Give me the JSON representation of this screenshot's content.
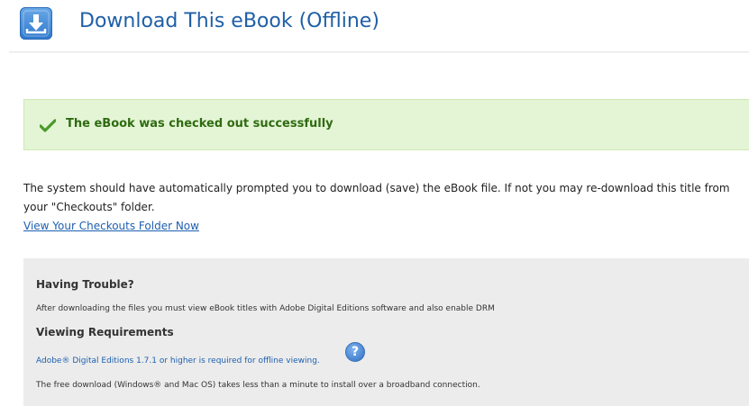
{
  "header": {
    "title": "Download This eBook (Offline)",
    "icon": "download-icon"
  },
  "alert": {
    "icon": "checkmark-icon",
    "message": "The eBook was checked out successfully"
  },
  "body": {
    "line1": "The system should have automatically prompted you to download (save) the eBook file. If not you may re-download this title from",
    "line2": "your \"Checkouts\" folder.",
    "link": "View Your Checkouts Folder Now"
  },
  "help": {
    "heading1": "Having Trouble?",
    "text1": "After downloading the files you must view eBook titles with Adobe Digital Editions software and also enable DRM",
    "heading2": "Viewing Requirements",
    "req_link": "Adobe® Digital Editions 1.7.1 or higher is required for offline viewing.",
    "help_icon": "?",
    "text2": "The free download (Windows® and Mac OS) takes less than a minute to install over a broadband connection."
  },
  "colors": {
    "title": "#1f5fa6",
    "success_bg": "#e4f5d5",
    "success_text": "#2f6b12",
    "link": "#1d5fb0",
    "panel_bg": "#ececec"
  }
}
